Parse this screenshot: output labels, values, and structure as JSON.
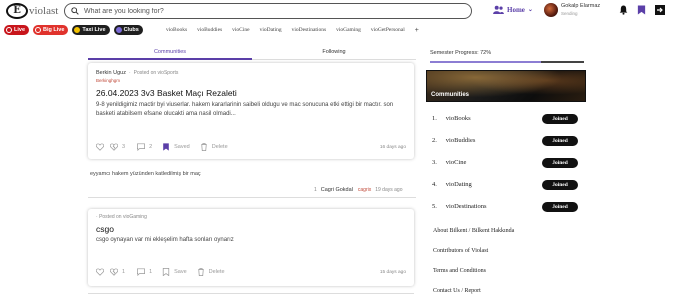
{
  "header": {
    "logo_mark": "E",
    "logo_text": "violast",
    "search_placeholder": "What are you looking for?",
    "home_label": "Home",
    "user": {
      "name": "Gokalp Elarmaz",
      "status": "Sending"
    }
  },
  "chips": [
    {
      "label": "Live"
    },
    {
      "label": "Big Live"
    },
    {
      "label": "Taxi Live"
    },
    {
      "label": "Clubs"
    }
  ],
  "categories": [
    "vioBooks",
    "vioBuddies",
    "vioCine",
    "vioDating",
    "vioDestinations",
    "vioGaming",
    "vioGetPersonal"
  ],
  "categories_more": "+",
  "tabs": {
    "communities": "Communities",
    "following": "Following"
  },
  "posts": [
    {
      "author": "Berkin Uguz",
      "posted_on": "Posted on vioSports",
      "sub": "Berkinghgm",
      "title": "26.04.2023 3v3 Basket Maçı Rezaleti",
      "body": "9-8 yenildigimiz mactir byi viuserlar. hakem kararlarinin saibeli oldugu ve mac sonucuna etki ettigi bir mactır. son basketi atabilsem efsane olucakti ama nasil olmadi...",
      "likes": "3",
      "comments": "2",
      "save_label": "Saved",
      "delete_label": "Delete",
      "date": "16 days ago"
    },
    {
      "author": "",
      "posted_on": "Posted on vioGaming",
      "sub": "",
      "title": "csgo",
      "body": "csgo oynayan var mi ekleşelim hafta sonları oynarız",
      "likes": "1",
      "comments": "1",
      "save_label": "Save",
      "delete_label": "Delete",
      "date": "15 days ago"
    }
  ],
  "comment": {
    "text": "eyyamcı hakem yüzünden katledilmiş bir maç",
    "votes": "1",
    "author": "Cagri Gokdal",
    "sub": "cagrix",
    "date": "19 days ago"
  },
  "progress": {
    "label": "Semester Progress: 72%",
    "value": 0.72
  },
  "communities": {
    "banner_label": "Communities",
    "items": [
      {
        "num": "1.",
        "name": "vioBooks",
        "status": "Joined"
      },
      {
        "num": "2.",
        "name": "vioBuddies",
        "status": "Joined"
      },
      {
        "num": "3.",
        "name": "vioCine",
        "status": "Joined"
      },
      {
        "num": "4.",
        "name": "vioDating",
        "status": "Joined"
      },
      {
        "num": "5.",
        "name": "vioDestinations",
        "status": "Joined"
      }
    ]
  },
  "footer_links": [
    "About Bilkent / Bilkent Hakkında",
    "Contributors of Violast",
    "Terms and Conditions",
    "Contact Us / Report"
  ]
}
